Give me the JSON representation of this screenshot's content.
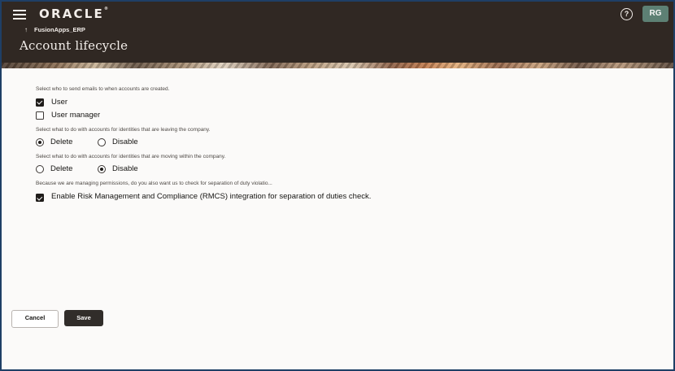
{
  "header": {
    "logo": "ORACLE",
    "logo_reg": "®",
    "back_label": "FusionApps_ERP",
    "title": "Account lifecycle",
    "help_icon": "question-circle-icon",
    "avatar_initials": "RG",
    "colors": {
      "header_bg": "#302823",
      "avatar_bg": "#5d8074"
    }
  },
  "form": {
    "emails_prompt": "Select who to send emails to when accounts are created.",
    "email_options": [
      {
        "label": "User",
        "checked": true
      },
      {
        "label": "User manager",
        "checked": false
      }
    ],
    "leaving_prompt": "Select what to do with accounts for identities that are leaving the company.",
    "leaving_options": [
      {
        "label": "Delete",
        "selected": true
      },
      {
        "label": "Disable",
        "selected": false
      }
    ],
    "moving_prompt": "Select what to do with accounts for identities that are moving within the company.",
    "moving_options": [
      {
        "label": "Delete",
        "selected": false
      },
      {
        "label": "Disable",
        "selected": true
      }
    ],
    "sod_prompt": "Because we are managing permissions, do you also want us to check for separation of duty violatio...",
    "rmcs": {
      "label": "Enable Risk Management and Compliance (RMCS) integration for separation of duties check.",
      "checked": true
    }
  },
  "actions": {
    "cancel_label": "Cancel",
    "save_label": "Save"
  }
}
